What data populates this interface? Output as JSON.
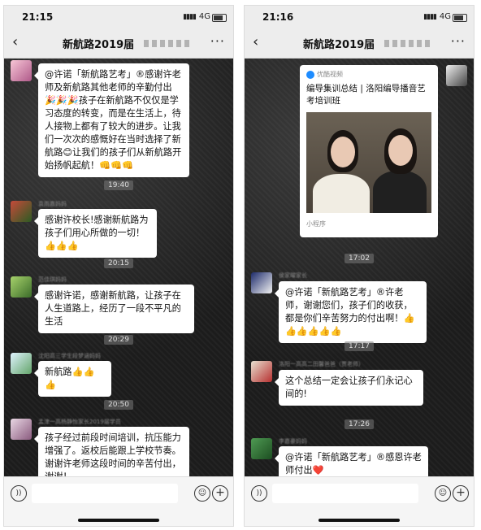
{
  "left": {
    "status": {
      "time": "21:15",
      "signal": "▮▮▮▮",
      "network": "4G"
    },
    "nav": {
      "back": "‹",
      "title": "新航路2019届",
      "more": "···"
    },
    "messages": [
      {
        "text": "@许诺「新航路艺考」®感谢许老师及新航路其他老师的辛勤付出🎉🎉🎉孩子在新航路不仅仅是学习态度的转变，而是在生活上，待人接物上都有了较大的进步。让我们一次次的感慨好在当时选择了新航路😊让我们的孩子们从新航路开始扬帆起航！👊👊👊"
      },
      {
        "text": "感谢许校长!感谢新航路为孩子们用心所做的一切！👍👍👍"
      },
      {
        "text": "感谢许诺，感谢新航路，让孩子在人生道路上，经历了一段不平凡的生活"
      },
      {
        "text": "新航路👍👍👍"
      },
      {
        "text": "孩子经过前段时间培训，抗压能力增强了。返校后能跟上学校节奏。谢谢许老师这段时间的辛苦付出，谢谢！"
      }
    ],
    "timestamps": [
      "19:40",
      "20:15",
      "20:29",
      "20:50"
    ],
    "usernames": [
      "袁雨嘉妈妈",
      "范佳琪妈妈",
      "沈阳高三学生段梦涵妈妈",
      "孟津一高杨静怡家长2019届学员"
    ]
  },
  "right": {
    "status": {
      "time": "21:16",
      "signal": "▮▮▮▮",
      "network": "4G"
    },
    "nav": {
      "back": "‹",
      "title": "新航路2019届",
      "more": "···"
    },
    "card": {
      "app": "优酷视频",
      "title": "编导集训总结 | 洛阳编导播音艺考培训班",
      "footer": "小程序"
    },
    "messages": [
      {
        "text": "@许诺「新航路艺考」®许老师，谢谢您们，孩子们的收获，都是你们辛苦努力的付出啊！👍👍👍👍👍👍"
      },
      {
        "text": "这个总结一定会让孩子们永记心间的!"
      },
      {
        "text": "@许诺「新航路艺考」®感恩许老师付出❤️"
      }
    ],
    "timestamps": [
      "17:02",
      "17:17",
      "17:26"
    ],
    "usernames": [
      "侯家曜家长",
      "洛阳一高高二田馨爸爸（贾老师）",
      "李嘉豪妈妈"
    ]
  },
  "icons": {
    "voice": "))",
    "emoji": "☺",
    "plus": "+"
  },
  "colors": {
    "chat_bg": "#222222",
    "bubble": "#ffffff",
    "bar": "#ededed",
    "video_logo": "#1e8cff"
  }
}
